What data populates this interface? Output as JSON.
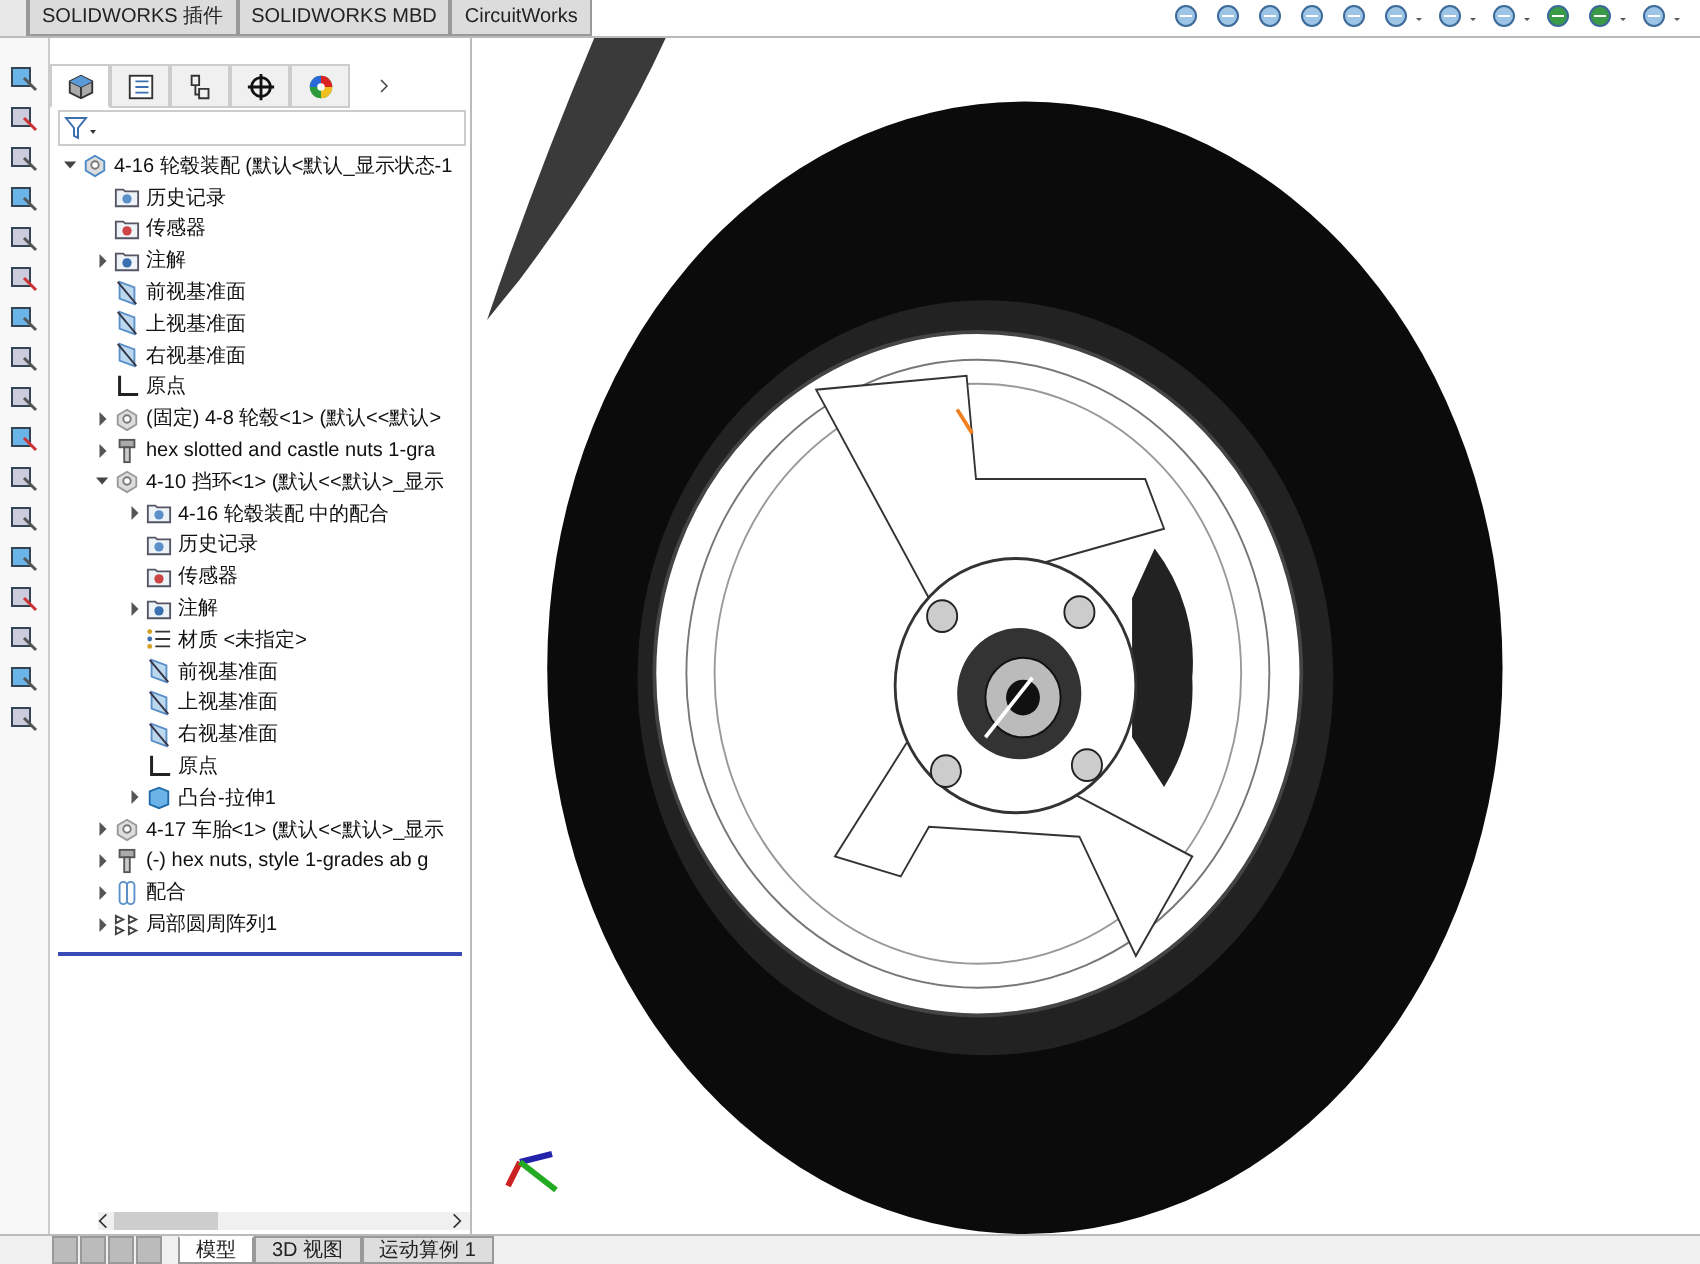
{
  "command_tabs": [
    {
      "label": "SOLIDWORKS 插件"
    },
    {
      "label": "SOLIDWORKS MBD"
    },
    {
      "label": "CircuitWorks"
    }
  ],
  "feature_manager": {
    "tabs": [
      {
        "kind": "features",
        "selected": true
      },
      {
        "kind": "properties",
        "selected": false
      },
      {
        "kind": "configurations",
        "selected": false
      },
      {
        "kind": "dimxpert",
        "selected": false
      },
      {
        "kind": "display",
        "selected": false
      }
    ],
    "tree": [
      {
        "label": "4-16 轮毂装配  (默认<默认_显示状态-1",
        "kind": "assembly",
        "expanded": true,
        "children": [
          {
            "label": "历史记录",
            "kind": "history"
          },
          {
            "label": "传感器",
            "kind": "sensor"
          },
          {
            "label": "注解",
            "kind": "annotation",
            "expanded": false
          },
          {
            "label": "前视基准面",
            "kind": "plane"
          },
          {
            "label": "上视基准面",
            "kind": "plane"
          },
          {
            "label": "右视基准面",
            "kind": "plane"
          },
          {
            "label": "原点",
            "kind": "origin"
          },
          {
            "label": "(固定) 4-8 轮毂<1> (默认<<默认>",
            "kind": "part",
            "expanded": false
          },
          {
            "label": "hex slotted and castle nuts 1-gra",
            "kind": "fastener",
            "expanded": false
          },
          {
            "label": "4-10 挡环<1> (默认<<默认>_显示",
            "kind": "part",
            "expanded": true,
            "children": [
              {
                "label": "4-16 轮毂装配 中的配合",
                "kind": "matefolder",
                "expanded": false
              },
              {
                "label": "历史记录",
                "kind": "history"
              },
              {
                "label": "传感器",
                "kind": "sensor"
              },
              {
                "label": "注解",
                "kind": "annotation",
                "expanded": false
              },
              {
                "label": "材质 <未指定>",
                "kind": "material"
              },
              {
                "label": "前视基准面",
                "kind": "plane"
              },
              {
                "label": "上视基准面",
                "kind": "plane"
              },
              {
                "label": "右视基准面",
                "kind": "plane"
              },
              {
                "label": "原点",
                "kind": "origin"
              },
              {
                "label": "凸台-拉伸1",
                "kind": "feature",
                "expanded": false
              }
            ]
          },
          {
            "label": "4-17 车胎<1> (默认<<默认>_显示",
            "kind": "part",
            "expanded": false
          },
          {
            "label": "(-) hex nuts, style 1-grades ab g",
            "kind": "fastener",
            "expanded": false
          },
          {
            "label": "配合",
            "kind": "mates",
            "expanded": false
          },
          {
            "label": "局部圆周阵列1",
            "kind": "pattern",
            "expanded": false
          }
        ]
      }
    ]
  },
  "bottom_tabs": [
    {
      "label": "模型",
      "selected": true
    },
    {
      "label": "3D 视图",
      "selected": false
    },
    {
      "label": "运动算例 1",
      "selected": false
    }
  ]
}
